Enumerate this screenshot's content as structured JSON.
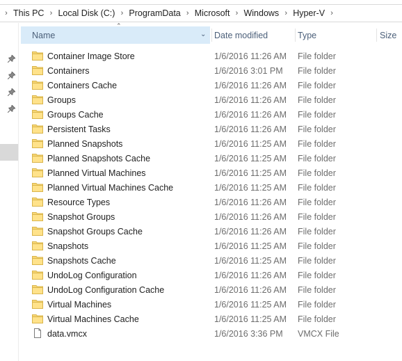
{
  "breadcrumb": [
    {
      "label": "This PC"
    },
    {
      "label": "Local Disk (C:)"
    },
    {
      "label": "ProgramData"
    },
    {
      "label": "Microsoft"
    },
    {
      "label": "Windows"
    },
    {
      "label": "Hyper-V"
    }
  ],
  "columns": {
    "name": "Name",
    "date_modified": "Date modified",
    "type": "Type",
    "size": "Size"
  },
  "sort": {
    "column": "name",
    "direction": "ascending"
  },
  "files": [
    {
      "name": "Container Image Store",
      "date": "1/6/2016 11:26 AM",
      "type": "File folder",
      "icon": "folder-icon"
    },
    {
      "name": "Containers",
      "date": "1/6/2016 3:01 PM",
      "type": "File folder",
      "icon": "folder-icon"
    },
    {
      "name": "Containers Cache",
      "date": "1/6/2016 11:26 AM",
      "type": "File folder",
      "icon": "folder-icon"
    },
    {
      "name": "Groups",
      "date": "1/6/2016 11:26 AM",
      "type": "File folder",
      "icon": "folder-icon"
    },
    {
      "name": "Groups Cache",
      "date": "1/6/2016 11:26 AM",
      "type": "File folder",
      "icon": "folder-icon"
    },
    {
      "name": "Persistent Tasks",
      "date": "1/6/2016 11:26 AM",
      "type": "File folder",
      "icon": "folder-icon"
    },
    {
      "name": "Planned Snapshots",
      "date": "1/6/2016 11:25 AM",
      "type": "File folder",
      "icon": "folder-icon"
    },
    {
      "name": "Planned Snapshots Cache",
      "date": "1/6/2016 11:25 AM",
      "type": "File folder",
      "icon": "folder-icon"
    },
    {
      "name": "Planned Virtual Machines",
      "date": "1/6/2016 11:25 AM",
      "type": "File folder",
      "icon": "folder-icon"
    },
    {
      "name": "Planned Virtual Machines Cache",
      "date": "1/6/2016 11:25 AM",
      "type": "File folder",
      "icon": "folder-icon"
    },
    {
      "name": "Resource Types",
      "date": "1/6/2016 11:26 AM",
      "type": "File folder",
      "icon": "folder-icon"
    },
    {
      "name": "Snapshot Groups",
      "date": "1/6/2016 11:26 AM",
      "type": "File folder",
      "icon": "folder-icon"
    },
    {
      "name": "Snapshot Groups Cache",
      "date": "1/6/2016 11:26 AM",
      "type": "File folder",
      "icon": "folder-icon"
    },
    {
      "name": "Snapshots",
      "date": "1/6/2016 11:25 AM",
      "type": "File folder",
      "icon": "folder-icon"
    },
    {
      "name": "Snapshots Cache",
      "date": "1/6/2016 11:25 AM",
      "type": "File folder",
      "icon": "folder-icon"
    },
    {
      "name": "UndoLog Configuration",
      "date": "1/6/2016 11:26 AM",
      "type": "File folder",
      "icon": "folder-icon"
    },
    {
      "name": "UndoLog Configuration Cache",
      "date": "1/6/2016 11:26 AM",
      "type": "File folder",
      "icon": "folder-icon"
    },
    {
      "name": "Virtual Machines",
      "date": "1/6/2016 11:25 AM",
      "type": "File folder",
      "icon": "folder-icon"
    },
    {
      "name": "Virtual Machines Cache",
      "date": "1/6/2016 11:25 AM",
      "type": "File folder",
      "icon": "folder-icon"
    },
    {
      "name": "data.vmcx",
      "date": "1/6/2016 3:36 PM",
      "type": "VMCX File",
      "icon": "file-icon"
    }
  ],
  "colors": {
    "header_selected_bg": "#d9ebf9",
    "header_text": "#4c607a",
    "folder_yellow": "#f8d775",
    "secondary_text": "#6d6d6d"
  }
}
